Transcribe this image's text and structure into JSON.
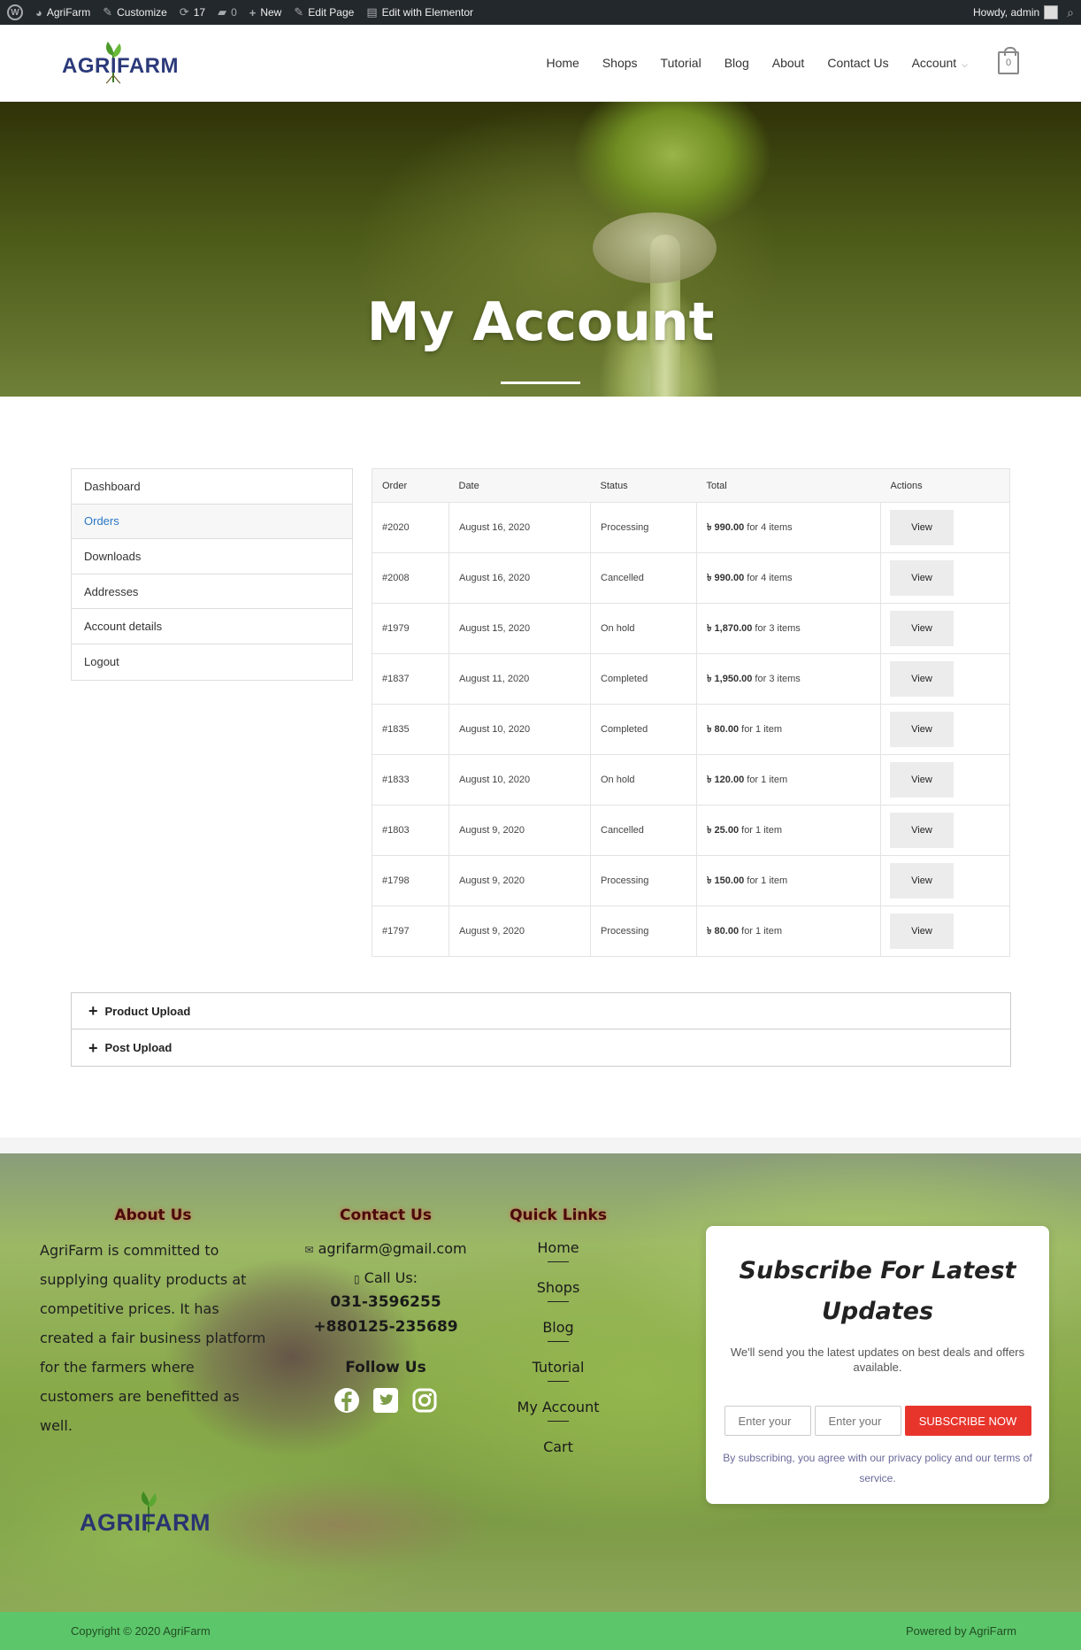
{
  "adminbar": {
    "site": "AgriFarm",
    "customize": "Customize",
    "updates": "17",
    "comments": "0",
    "new": "New",
    "edit_page": "Edit Page",
    "elementor": "Edit with Elementor",
    "howdy": "Howdy, admin"
  },
  "header": {
    "logo": "AGRIFARM",
    "nav": [
      "Home",
      "Shops",
      "Tutorial",
      "Blog",
      "About",
      "Contact Us",
      "Account"
    ],
    "cart_count": "0"
  },
  "hero": {
    "title": "My Account"
  },
  "account_nav": [
    {
      "label": "Dashboard"
    },
    {
      "label": "Orders",
      "active": true
    },
    {
      "label": "Downloads"
    },
    {
      "label": "Addresses"
    },
    {
      "label": "Account details"
    },
    {
      "label": "Logout"
    }
  ],
  "orders": {
    "headers": [
      "Order",
      "Date",
      "Status",
      "Total",
      "Actions"
    ],
    "currency": "৳",
    "rows": [
      {
        "order": "#2020",
        "date": "August 16, 2020",
        "status": "Processing",
        "amount": "990.00",
        "items": " for 4 items",
        "action": "View"
      },
      {
        "order": "#2008",
        "date": "August 16, 2020",
        "status": "Cancelled",
        "amount": "990.00",
        "items": " for 4 items",
        "action": "View"
      },
      {
        "order": "#1979",
        "date": "August 15, 2020",
        "status": "On hold",
        "amount": "1,870.00",
        "items": " for 3 items",
        "action": "View"
      },
      {
        "order": "#1837",
        "date": "August 11, 2020",
        "status": "Completed",
        "amount": "1,950.00",
        "items": " for 3 items",
        "action": "View"
      },
      {
        "order": "#1835",
        "date": "August 10, 2020",
        "status": "Completed",
        "amount": "80.00",
        "items": " for 1 item",
        "action": "View"
      },
      {
        "order": "#1833",
        "date": "August 10, 2020",
        "status": "On hold",
        "amount": "120.00",
        "items": " for 1 item",
        "action": "View"
      },
      {
        "order": "#1803",
        "date": "August 9, 2020",
        "status": "Cancelled",
        "amount": "25.00",
        "items": " for 1 item",
        "action": "View"
      },
      {
        "order": "#1798",
        "date": "August 9, 2020",
        "status": "Processing",
        "amount": "150.00",
        "items": " for 1 item",
        "action": "View"
      },
      {
        "order": "#1797",
        "date": "August 9, 2020",
        "status": "Processing",
        "amount": "80.00",
        "items": " for 1 item",
        "action": "View"
      }
    ]
  },
  "uploads": {
    "product": "Product Upload",
    "post": "Post Upload"
  },
  "footer": {
    "about_heading": "About Us",
    "about_text": "AgriFarm is committed to supplying quality products at competitive prices. It has created a fair business platform for the farmers where customers are benefitted as well.",
    "contact_heading": "Contact Us",
    "email": "agrifarm@gmail.com",
    "call_us": "Call Us:",
    "phone1": "031-3596255",
    "phone2": "+880125-235689",
    "follow_us": "Follow Us",
    "quick_heading": "Quick Links",
    "quick_links": [
      "Home",
      "Shops",
      "Blog",
      "Tutorial",
      "My Account",
      "Cart"
    ],
    "logo": "AGRIFARM"
  },
  "subscribe": {
    "title": "Subscribe For Latest Updates",
    "text": "We'll send you the latest updates on best deals and offers available.",
    "input1_placeholder": "Enter your",
    "input2_placeholder": "Enter your",
    "button": "SUBSCRIBE NOW",
    "note": "By subscribing, you agree with our privacy policy and our terms of service."
  },
  "copyright": {
    "left": "Copyright © 2020 AgriFarm",
    "right": "Powered by AgriFarm"
  },
  "colors": {
    "accent": "#2a78c5",
    "subscribe_button": "#e8352c",
    "copyright_bar": "#5cc66a",
    "adminbar": "#23282d"
  }
}
